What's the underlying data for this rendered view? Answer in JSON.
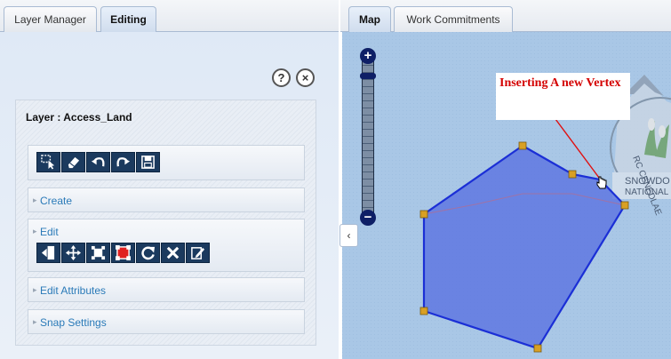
{
  "left_tabs": [
    {
      "label": "Layer Manager"
    },
    {
      "label": "Editing"
    }
  ],
  "panel_controls": {
    "help": "?",
    "close": "×"
  },
  "layer": {
    "title": "Layer : Access_Land"
  },
  "tools_row": [
    {
      "icon": "select-feature-icon"
    },
    {
      "icon": "eraser-icon"
    },
    {
      "icon": "undo-icon"
    },
    {
      "icon": "redo-icon"
    },
    {
      "icon": "save-icon"
    }
  ],
  "sections": {
    "create": "Create",
    "edit": "Edit",
    "edit_attributes": "Edit Attributes",
    "snap_settings": "Snap Settings"
  },
  "edit_tools": [
    {
      "icon": "split-icon"
    },
    {
      "icon": "move-icon"
    },
    {
      "icon": "vertex-icon"
    },
    {
      "icon": "delete-vertex-icon"
    },
    {
      "icon": "rotate-icon"
    },
    {
      "icon": "delete-icon"
    },
    {
      "icon": "edit-attributes-icon"
    }
  ],
  "right_tabs": [
    {
      "label": "Map"
    },
    {
      "label": "Work Commitments"
    }
  ],
  "map": {
    "annotation": "Inserting A new Vertex",
    "zoom_in": "+",
    "zoom_out": "−",
    "collapse": "‹",
    "watermark_text_1": "RC CENEDLAE",
    "watermark_text_2": "SNOWDO",
    "watermark_text_3": "NATIONAL"
  },
  "colors": {
    "polygon_fill": "#5b74e0",
    "polygon_stroke": "#1b2fd6",
    "vertex": "#d9a024",
    "annotation_text": "#d40000",
    "map_bg": "#a9c7e6"
  }
}
